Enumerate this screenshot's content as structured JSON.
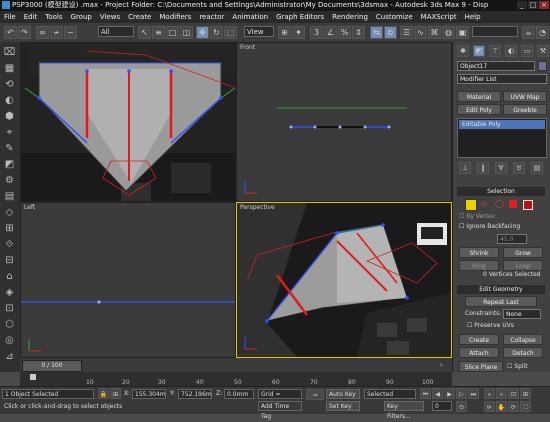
{
  "window": {
    "title": "PSP3000 (模型建设) .max - Project Folder: C:\\Documents and Settings\\Administrator\\My Documents\\3dsmax - Autodesk 3ds Max 9 - Disp",
    "minimize": "_",
    "maximize": "□",
    "close": "×"
  },
  "menu": [
    "File",
    "Edit",
    "Tools",
    "Group",
    "Views",
    "Create",
    "Modifiers",
    "reactor",
    "Animation",
    "Graph Editors",
    "Rendering",
    "Customize",
    "MAXScript",
    "Help"
  ],
  "toolbar": {
    "selection_filter": "All",
    "reference_coord": "View"
  },
  "viewports": {
    "top_left": "",
    "front": "Front",
    "left": "Left",
    "perspective": "Perspective"
  },
  "command_panel": {
    "object_name": "Object17",
    "modifier_list": "Modifier List",
    "buttons": [
      "Material",
      "UVW Map",
      "Edit Poly",
      "Greeble"
    ],
    "stack_item": "Editable Poly",
    "selection": {
      "header": "Selection",
      "by_vertex": "By Vertex",
      "ignore_backfacing": "Ignore Backfacing",
      "angle_value": "45.0",
      "shrink": "Shrink",
      "grow": "Grow",
      "ring": "Ring",
      "loop": "Loop",
      "status": "0 Vertices Selected"
    },
    "edit_geometry": {
      "header": "Edit Geometry",
      "repeat_last": "Repeat Last",
      "constraints_label": "Constraints:",
      "constraints_value": "None",
      "preserve_uvs": "Preserve UVs",
      "create": "Create",
      "collapse": "Collapse",
      "attach": "Attach",
      "detach": "Detach",
      "slice_plane": "Slice Plane",
      "split": "Split"
    }
  },
  "timeline": {
    "frame_counter": "0 / 100",
    "ticks": [
      "10",
      "20",
      "30",
      "40",
      "50",
      "60",
      "70",
      "80",
      "90",
      "100"
    ]
  },
  "status": {
    "selected": "1 Object Selected",
    "prompt": "Click or click-and-drag to select objects",
    "x_label": "X:",
    "x_value": "155.304m",
    "y_label": "Y:",
    "y_value": "752.196m",
    "z_label": "Z:",
    "z_value": "0.0mm",
    "grid": "Grid = 10.0mm",
    "add_time_tag": "Add Time Tag",
    "auto_key": "Auto Key",
    "auto_key_value": "Selected",
    "set_key": "Set Key",
    "key_filters": "Key Filters...",
    "current_frame": "0"
  },
  "colors": {
    "mesh_red": "#e01a1a",
    "edge_blue": "#3050ff",
    "active_border": "#e8c200"
  }
}
